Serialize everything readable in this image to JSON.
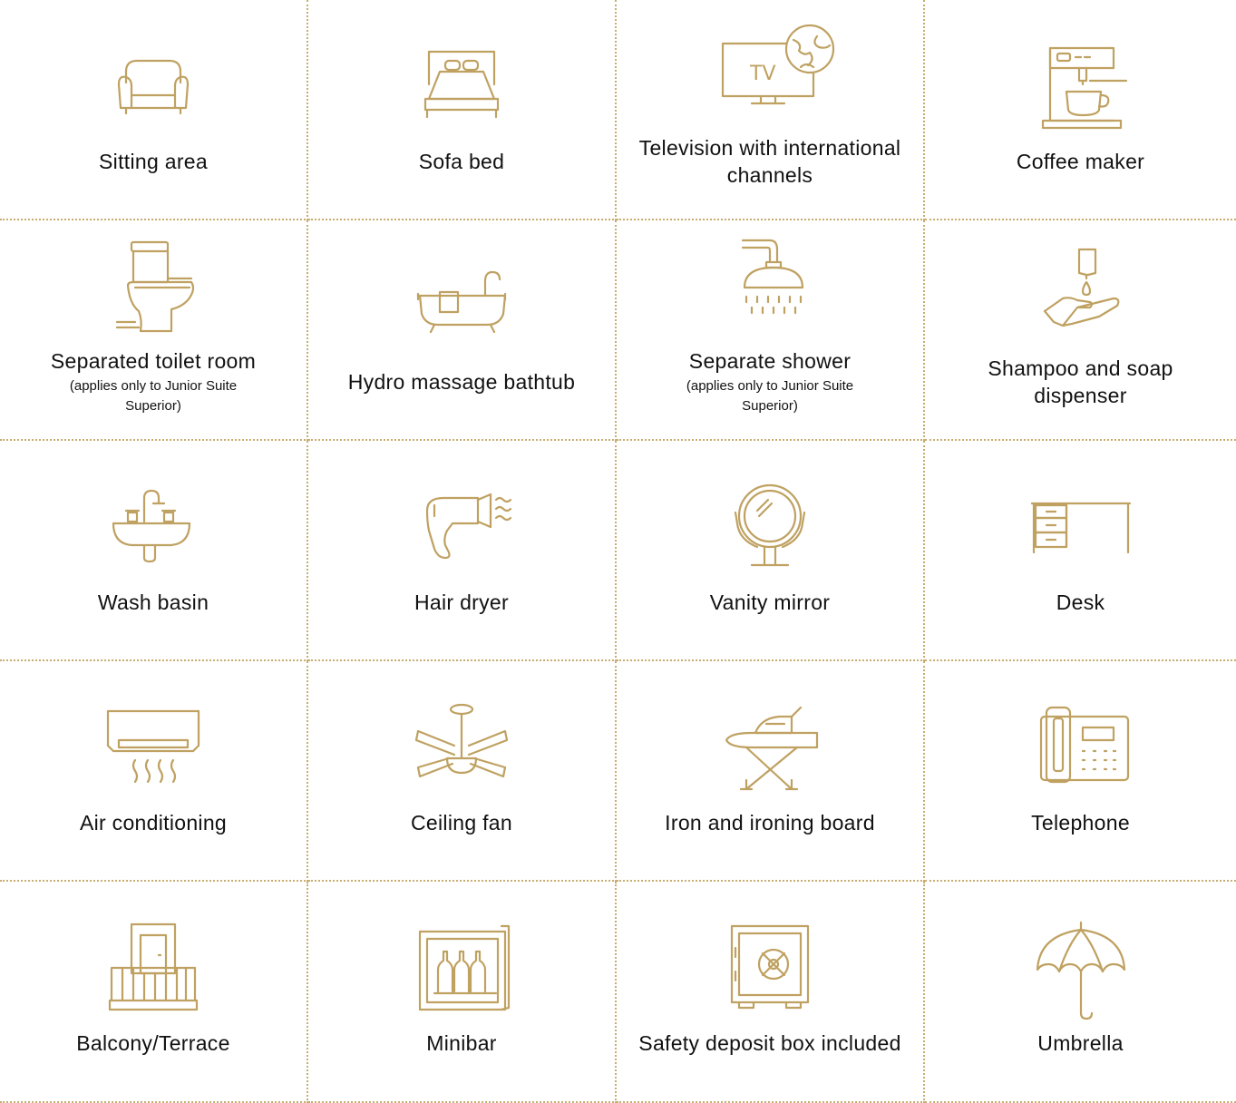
{
  "accent_color": "#bfa161",
  "amenities": [
    {
      "label": "Sitting area",
      "icon": "armchair-icon"
    },
    {
      "label": "Sofa bed",
      "icon": "bed-icon"
    },
    {
      "label": "Television with international channels",
      "icon": "tv-globe-icon"
    },
    {
      "label": "Coffee maker",
      "icon": "coffee-machine-icon"
    },
    {
      "label": "Separated toilet room",
      "note": "(applies only to Junior Suite Superior)",
      "icon": "toilet-icon"
    },
    {
      "label": "Hydro massage bathtub",
      "icon": "bathtub-icon"
    },
    {
      "label": "Separate shower",
      "note": "(applies only to Junior Suite Superior)",
      "icon": "shower-icon"
    },
    {
      "label": "Shampoo and soap dispenser",
      "icon": "soap-dispenser-icon"
    },
    {
      "label": "Wash basin",
      "icon": "sink-icon"
    },
    {
      "label": "Hair dryer",
      "icon": "hair-dryer-icon"
    },
    {
      "label": "Vanity mirror",
      "icon": "mirror-icon"
    },
    {
      "label": "Desk",
      "icon": "desk-icon"
    },
    {
      "label": "Air conditioning",
      "icon": "air-conditioner-icon"
    },
    {
      "label": "Ceiling fan",
      "icon": "ceiling-fan-icon"
    },
    {
      "label": "Iron and ironing board",
      "icon": "iron-icon"
    },
    {
      "label": "Telephone",
      "icon": "telephone-icon"
    },
    {
      "label": "Balcony/Terrace",
      "icon": "balcony-icon"
    },
    {
      "label": "Minibar",
      "icon": "minibar-icon"
    },
    {
      "label": "Safety deposit box included",
      "icon": "safe-icon"
    },
    {
      "label": "Umbrella",
      "icon": "umbrella-icon"
    }
  ],
  "tv_text": "TV"
}
